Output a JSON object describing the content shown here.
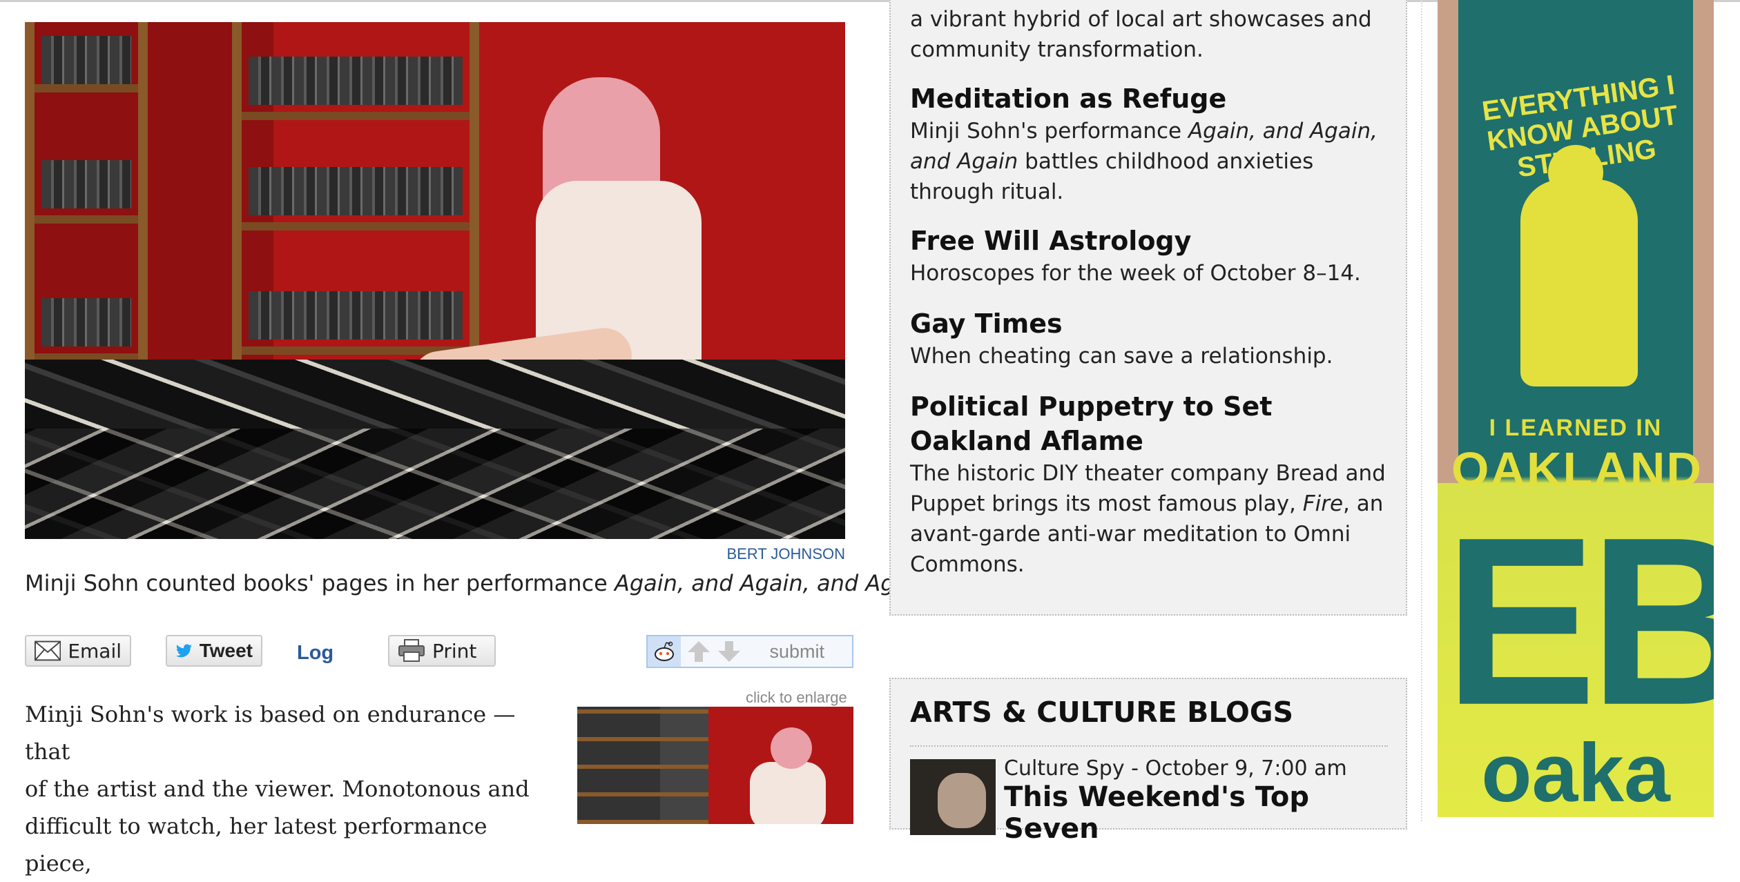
{
  "article": {
    "photo_credit": "BERT JOHNSON",
    "caption_plain": "Minji Sohn counted books' pages in her performance ",
    "caption_italic": "Again, and Again, and Again",
    "caption_end": ".",
    "share": {
      "email_label": "Email",
      "tweet_label": "Tweet",
      "log_label": "Log",
      "print_label": "Print",
      "reddit_submit_label": "submit"
    },
    "enlarge_label": "click to enlarge",
    "body_lines": [
      "Minji Sohn's work is based on endurance — that",
      "of the artist and the viewer. Monotonous and",
      "difficult to watch, her latest performance piece,"
    ]
  },
  "sidebar": {
    "top_fragment": "a vibrant hybrid of local art showcases and community transformation.",
    "items": [
      {
        "title": "Meditation as Refuge",
        "desc_before": "Minji Sohn's performance ",
        "desc_italic": "Again, and Again, and Again",
        "desc_after": " battles childhood anxieties through ritual."
      },
      {
        "title": "Free Will Astrology",
        "desc": "Horoscopes for the week of October 8–14."
      },
      {
        "title": "Gay Times",
        "desc": "When cheating can save a relationship."
      },
      {
        "title": "Political Puppetry to Set Oakland Aflame",
        "desc_before": "The historic DIY theater company Bread and Puppet brings its most famous play, ",
        "desc_italic": "Fire",
        "desc_after": ", an avant-garde anti-war meditation to Omni Commons."
      }
    ]
  },
  "blogs": {
    "heading": "ARTS & CULTURE BLOGS",
    "entries": [
      {
        "meta": "Culture Spy - October 9, 7:00 am",
        "headline": "This Weekend's Top Seven"
      }
    ]
  },
  "ad": {
    "shirt_text": "EVERYTHING I KNOW ABOUT STEALING",
    "shirt_text2": "I LEARNED IN",
    "shirt_city": "OAKLAND",
    "brand_big": "EBX",
    "brand_small": "oaka"
  },
  "colors": {
    "link_blue": "#2a5b9a",
    "sidebar_bg": "#f1f1f1",
    "ad_teal": "#1f6f6c",
    "ad_yellow": "#e3df3d"
  }
}
